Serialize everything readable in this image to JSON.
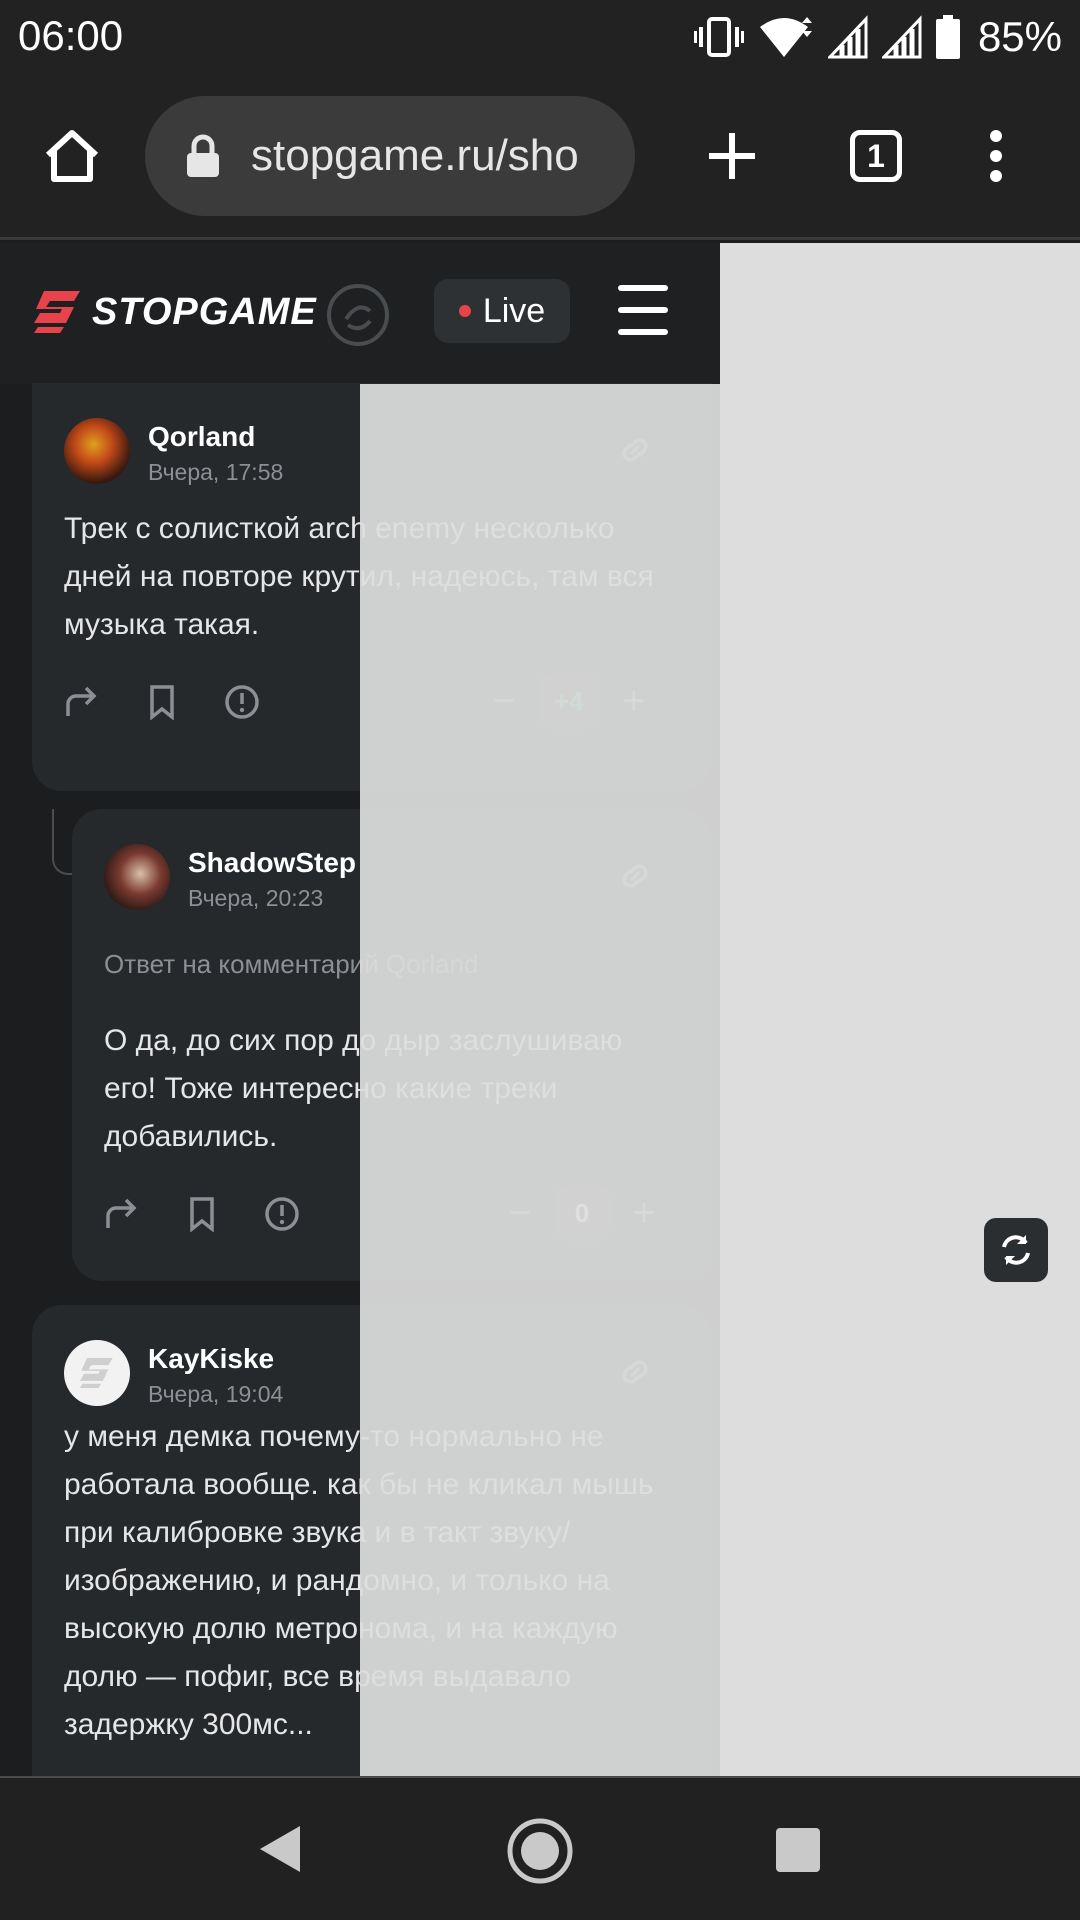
{
  "status_bar": {
    "time": "06:00",
    "battery": "85%"
  },
  "browser": {
    "url": "stopgame.ru/sho",
    "tab_count": "1"
  },
  "site": {
    "logo_text": "STOPGAME",
    "live_label": "Live"
  },
  "comments": [
    {
      "author": "Qorland",
      "time": "Вчера, 17:58",
      "text": "Трек с солисткой arch enemy несколько дней на повторе крутил, надеюсь, там вся музыка такая.",
      "score": "+4"
    },
    {
      "author": "ShadowStep",
      "time": "Вчера, 20:23",
      "reply_to": "Ответ на комментарий Qorland",
      "text": "О да, до сих пор до дыр заслушиваю его! Тоже интересно какие треки добавились.",
      "score": "0"
    },
    {
      "author": "KayKiske",
      "time": "Вчера, 19:04",
      "text": "у меня демка почему-то нормально не работала вообще. как бы не кликал мышь при калибровке звука и в такт звуку/изображению, и рандомно, и только на высокую долю метронома, и на каждую долю — пофиг, все время выдавало задержку 300мс..."
    }
  ],
  "colors": {
    "accent": "#e8424a",
    "positive": "#25c05a",
    "card": "#26292c"
  }
}
